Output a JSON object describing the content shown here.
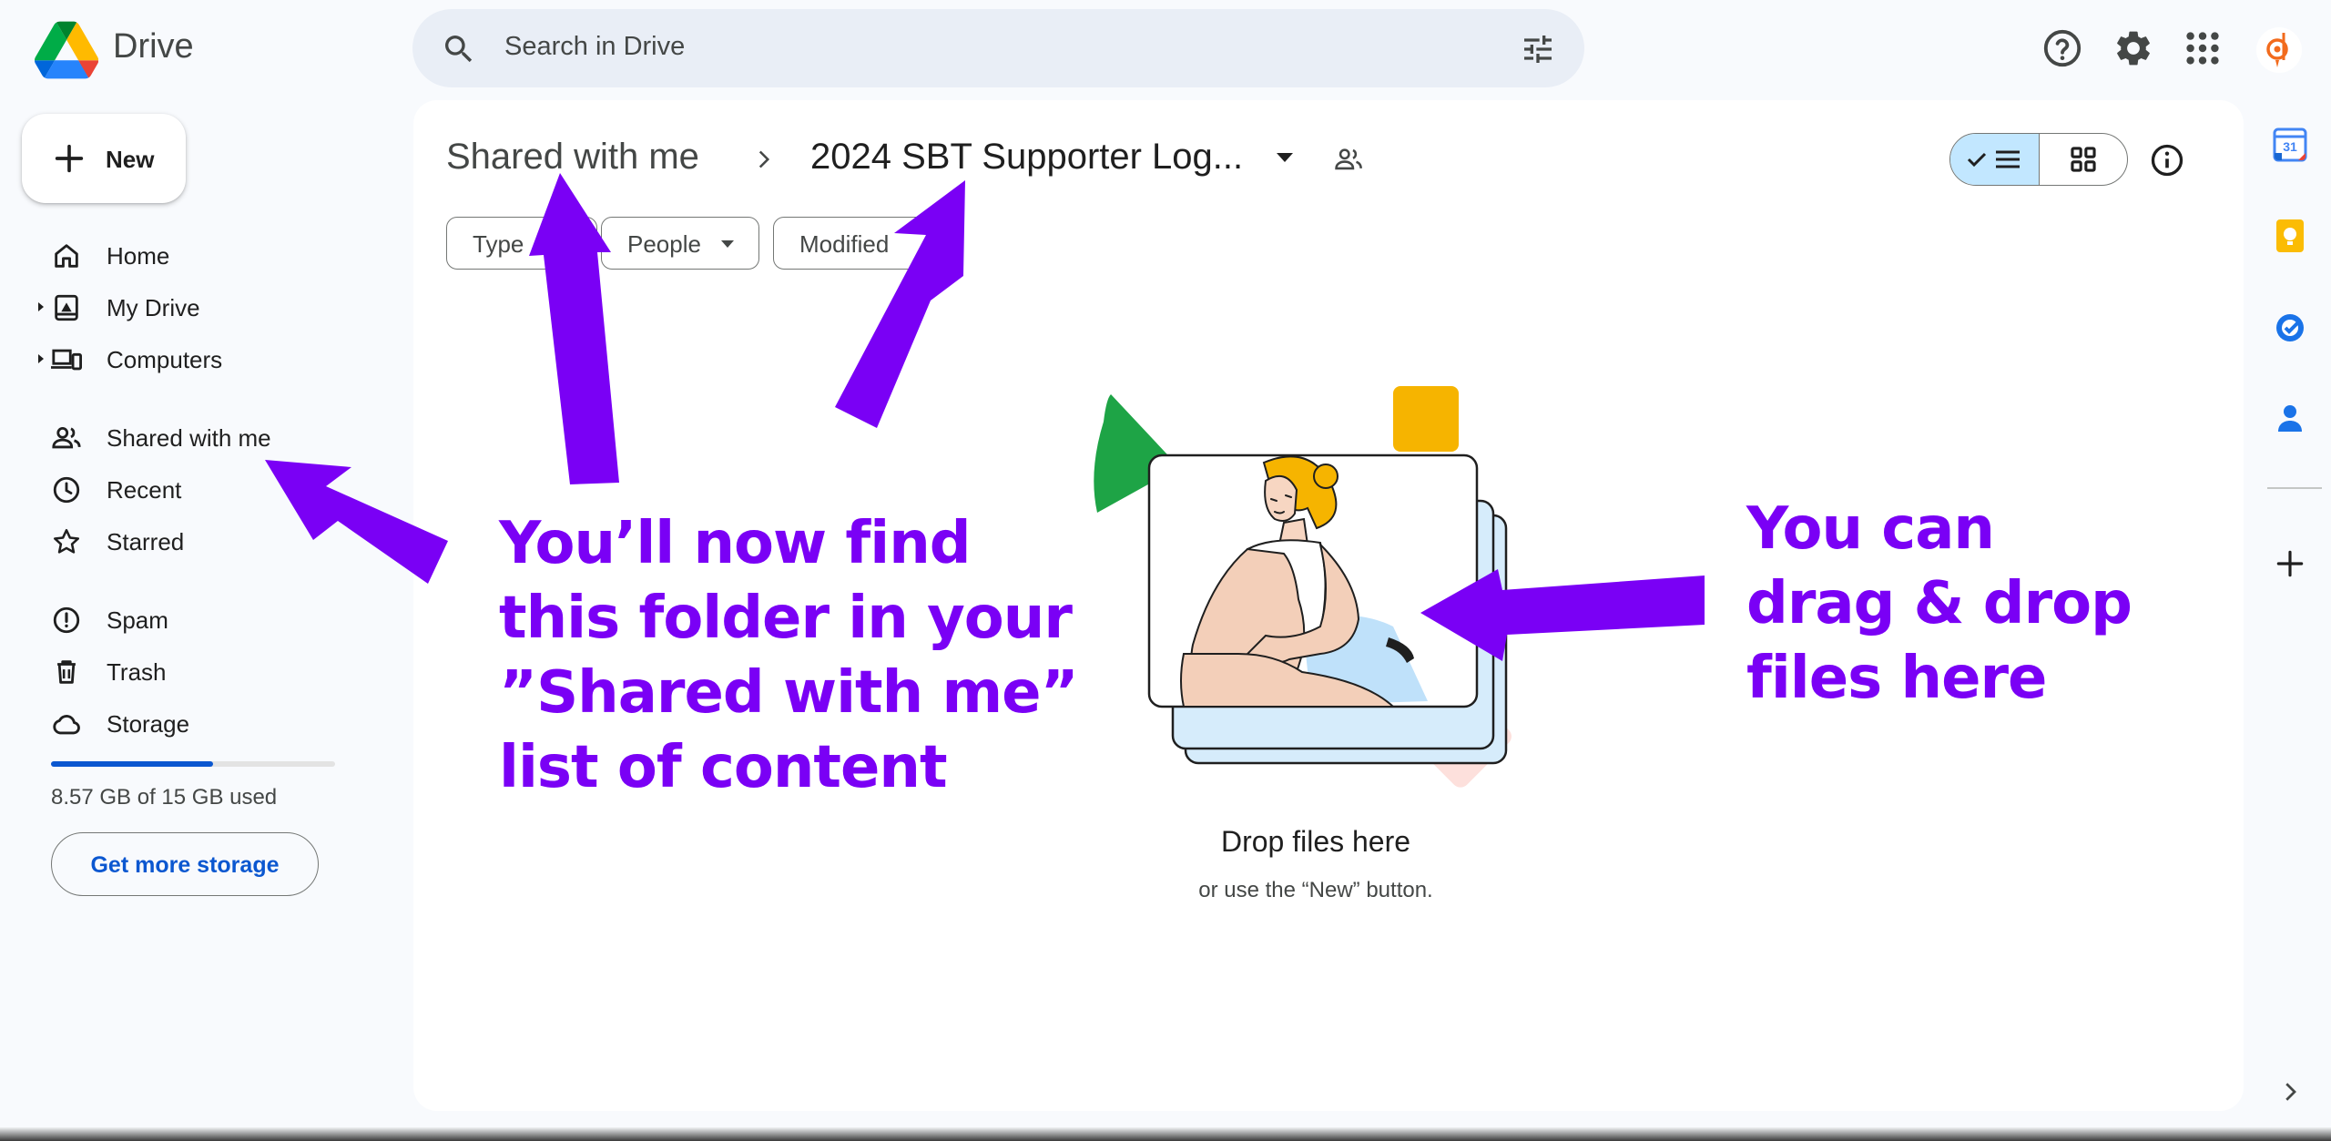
{
  "app": {
    "brand": "Drive"
  },
  "search": {
    "placeholder": "Search in Drive"
  },
  "sidebar": {
    "new_label": "New",
    "items": [
      {
        "label": "Home",
        "icon": "home-icon"
      },
      {
        "label": "My Drive",
        "icon": "my-drive-icon"
      },
      {
        "label": "Computers",
        "icon": "computers-icon"
      },
      {
        "label": "Shared with me",
        "icon": "shared-with-me-icon"
      },
      {
        "label": "Recent",
        "icon": "clock-icon"
      },
      {
        "label": "Starred",
        "icon": "star-icon"
      },
      {
        "label": "Spam",
        "icon": "spam-icon"
      },
      {
        "label": "Trash",
        "icon": "trash-icon"
      },
      {
        "label": "Storage",
        "icon": "cloud-icon"
      }
    ],
    "storage": {
      "text": "8.57 GB of 15 GB used",
      "used_fraction": 0.571
    },
    "get_storage_label": "Get more storage"
  },
  "main": {
    "breadcrumb": {
      "parent": "Shared with me",
      "current": "2024 SBT Supporter Log..."
    },
    "filters": [
      "Type",
      "People",
      "Modified"
    ],
    "empty_state": {
      "title": "Drop files here",
      "subtitle": "or use the “New” button."
    }
  },
  "annotations": {
    "left": "You’ll now find\nthis folder in your\n”Shared with me”\nlist of content",
    "right": "You can\ndrag & drop\nfiles here"
  },
  "side_panel": {
    "calendar_day": "31"
  },
  "colors": {
    "accent": "#0b57d0",
    "annotation": "#7a00f5",
    "selected": "#c2e7ff"
  }
}
